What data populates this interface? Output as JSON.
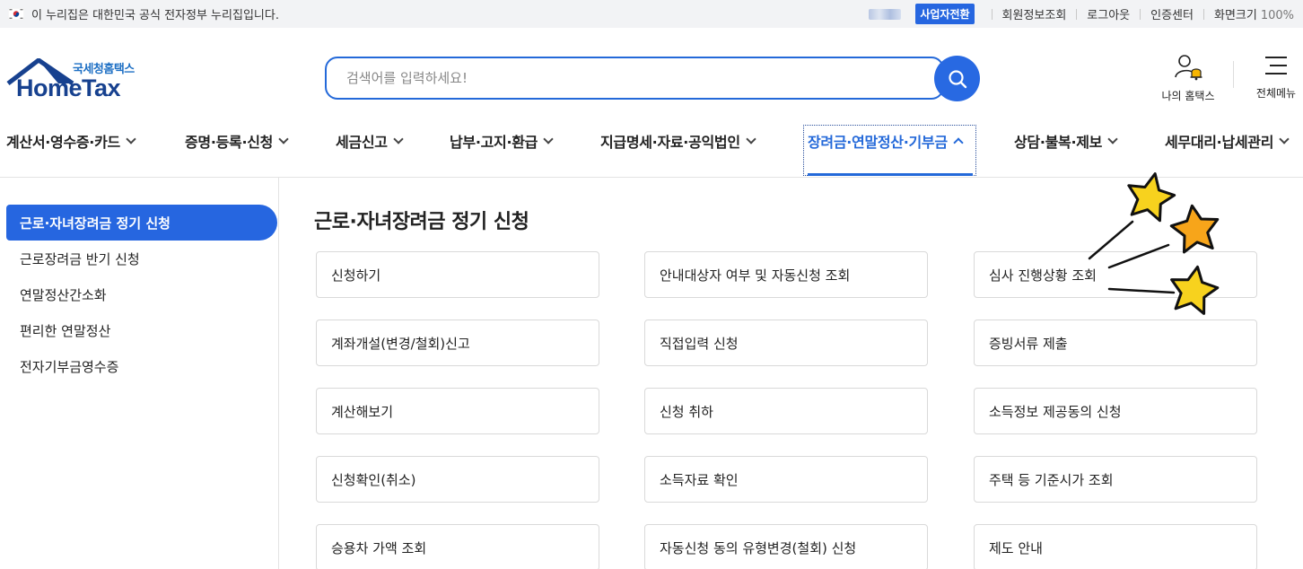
{
  "topbar": {
    "gov_notice": "이 누리집은 대한민국 공식 전자정부 누리집입니다.",
    "switch_label": "사업자전환",
    "links": [
      "회원정보조회",
      "로그아웃",
      "인증센터"
    ],
    "zoom_label": "화면크기",
    "zoom_value": "100%"
  },
  "header": {
    "logo_sub": "국세청홈택스",
    "logo_main": "HomeTax",
    "search_placeholder": "검색어를 입력하세요!",
    "my_home_label": "나의 홈택스",
    "all_menu_label": "전체메뉴"
  },
  "gnb": {
    "items": [
      "계산서·영수증·카드",
      "증명·등록·신청",
      "세금신고",
      "납부·고지·환급",
      "지급명세·자료·공익법인",
      "장려금·연말정산·기부금",
      "상담·불복·제보",
      "세무대리·납세관리"
    ],
    "active_index": 5
  },
  "sidebar": {
    "items": [
      "근로·자녀장려금 정기 신청",
      "근로장려금 반기 신청",
      "연말정산간소화",
      "편리한 연말정산",
      "전자기부금영수증"
    ],
    "active_index": 0
  },
  "main": {
    "title": "근로·자녀장려금 정기 신청",
    "cards": [
      "신청하기",
      "안내대상자 여부 및 자동신청 조회",
      "심사 진행상황 조회",
      "계좌개설(변경/철회)신고",
      "직접입력 신청",
      "증빙서류 제출",
      "계산해보기",
      "신청 취하",
      "소득정보 제공동의 신청",
      "신청확인(취소)",
      "소득자료 확인",
      "주택 등 기준시가 조회",
      "승용차 가액 조회",
      "자동신청 동의 유형변경(철회) 신청",
      "제도 안내"
    ]
  },
  "colors": {
    "primary": "#2666e0",
    "logo_navy": "#17418f",
    "star_yellow": "#f7d21e",
    "star_orange": "#f7a51a"
  },
  "icons": [
    "korea-flag-icon",
    "search-icon",
    "user-bell-icon",
    "hamburger-icon",
    "chevron-down-icon",
    "chevron-up-icon",
    "star-icon"
  ]
}
